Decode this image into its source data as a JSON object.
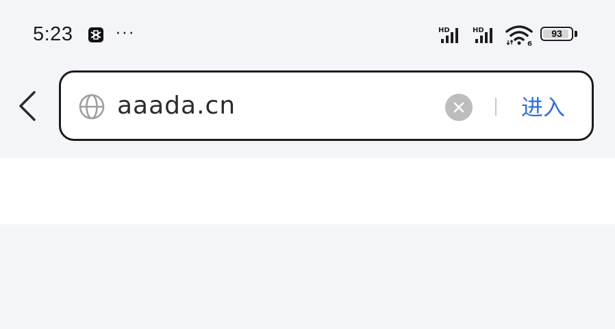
{
  "status_bar": {
    "time": "5:23",
    "more": "···",
    "signal_1_label": "HD",
    "signal_2_label": "HD",
    "wifi_label": "6",
    "battery_level": "93",
    "battery_fraction": 0.93,
    "icons": [
      "capcut-icon",
      "signal-icon",
      "signal-icon",
      "wifi-icon",
      "battery-icon"
    ]
  },
  "address_bar": {
    "url": "aaada.cn",
    "enter_label": "进入",
    "icons": [
      "back-icon",
      "globe-icon",
      "clear-icon"
    ]
  },
  "colors": {
    "accent": "#2f6fe6",
    "background": "#f4f5f9",
    "panel": "#ffffff",
    "clear_button": "#bdbdbd"
  }
}
